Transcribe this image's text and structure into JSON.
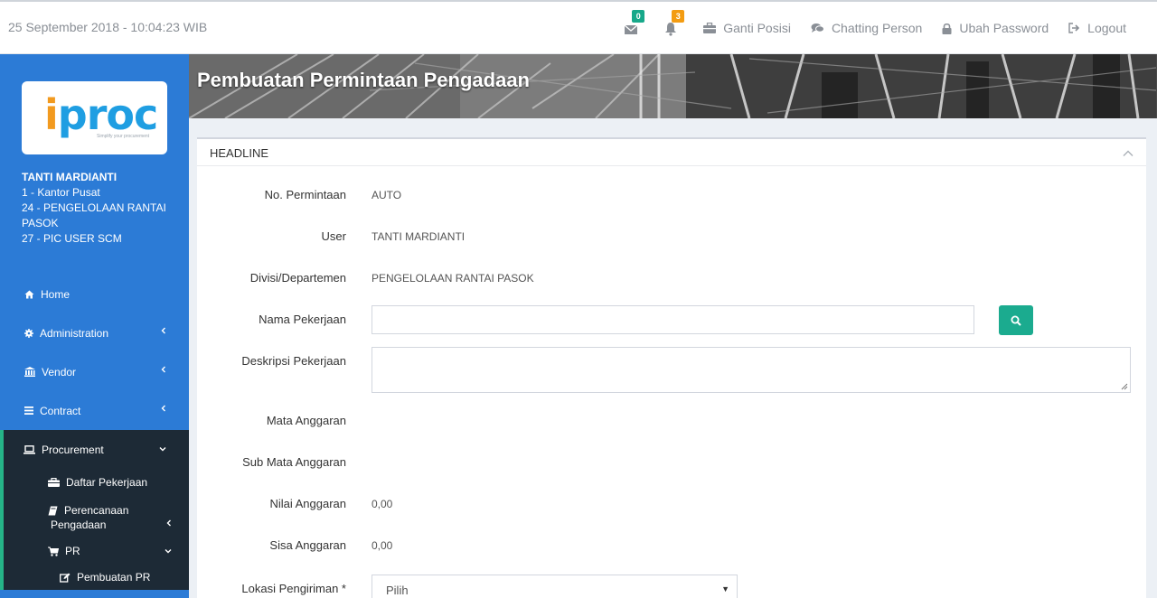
{
  "header": {
    "datetime": "25 September 2018 - 10:04:23 WIB",
    "mail_count": "0",
    "notif_count": "3",
    "ganti_posisi": "Ganti Posisi",
    "chatting": "Chatting Person",
    "ubah_password": "Ubah Password",
    "logout": "Logout",
    "mail_color": "#17a88a",
    "notif_color": "#f39c12"
  },
  "sidebar": {
    "logo_text_i": "i",
    "logo_text_rest": "proc",
    "logo_tagline": "Simplify your procurement",
    "user_name": "TANTI MARDIANTI",
    "user_lines": [
      "1 - Kantor Pusat",
      "24 - PENGELOLAAN RANTAI PASOK",
      "27 - PIC USER SCM"
    ],
    "menu": {
      "home": "Home",
      "administration": "Administration",
      "vendor": "Vendor",
      "contract": "Contract",
      "procurement": "Procurement",
      "daftar_pekerjaan": "Daftar Pekerjaan",
      "perencanaan_1": "Perencanaan",
      "perencanaan_2": "Pengadaan",
      "pr": "PR",
      "pembuatan_pr": "Pembuatan PR"
    }
  },
  "page": {
    "title": "Pembuatan Permintaan Pengadaan",
    "panel_title": "HEADLINE"
  },
  "form": {
    "no_permintaan_label": "No. Permintaan",
    "no_permintaan_value": "AUTO",
    "user_label": "User",
    "user_value": "TANTI MARDIANTI",
    "divisi_label": "Divisi/Departemen",
    "divisi_value": "PENGELOLAAN RANTAI PASOK",
    "nama_pekerjaan_label": "Nama Pekerjaan",
    "nama_pekerjaan_value": "",
    "deskripsi_label": "Deskripsi Pekerjaan",
    "deskripsi_value": "",
    "mata_anggaran_label": "Mata Anggaran",
    "sub_mata_anggaran_label": "Sub Mata Anggaran",
    "nilai_anggaran_label": "Nilai Anggaran",
    "nilai_anggaran_value": "0,00",
    "sisa_anggaran_label": "Sisa Anggaran",
    "sisa_anggaran_value": "0,00",
    "lokasi_label": "Lokasi Pengiriman *",
    "lokasi_value": "Pilih"
  }
}
